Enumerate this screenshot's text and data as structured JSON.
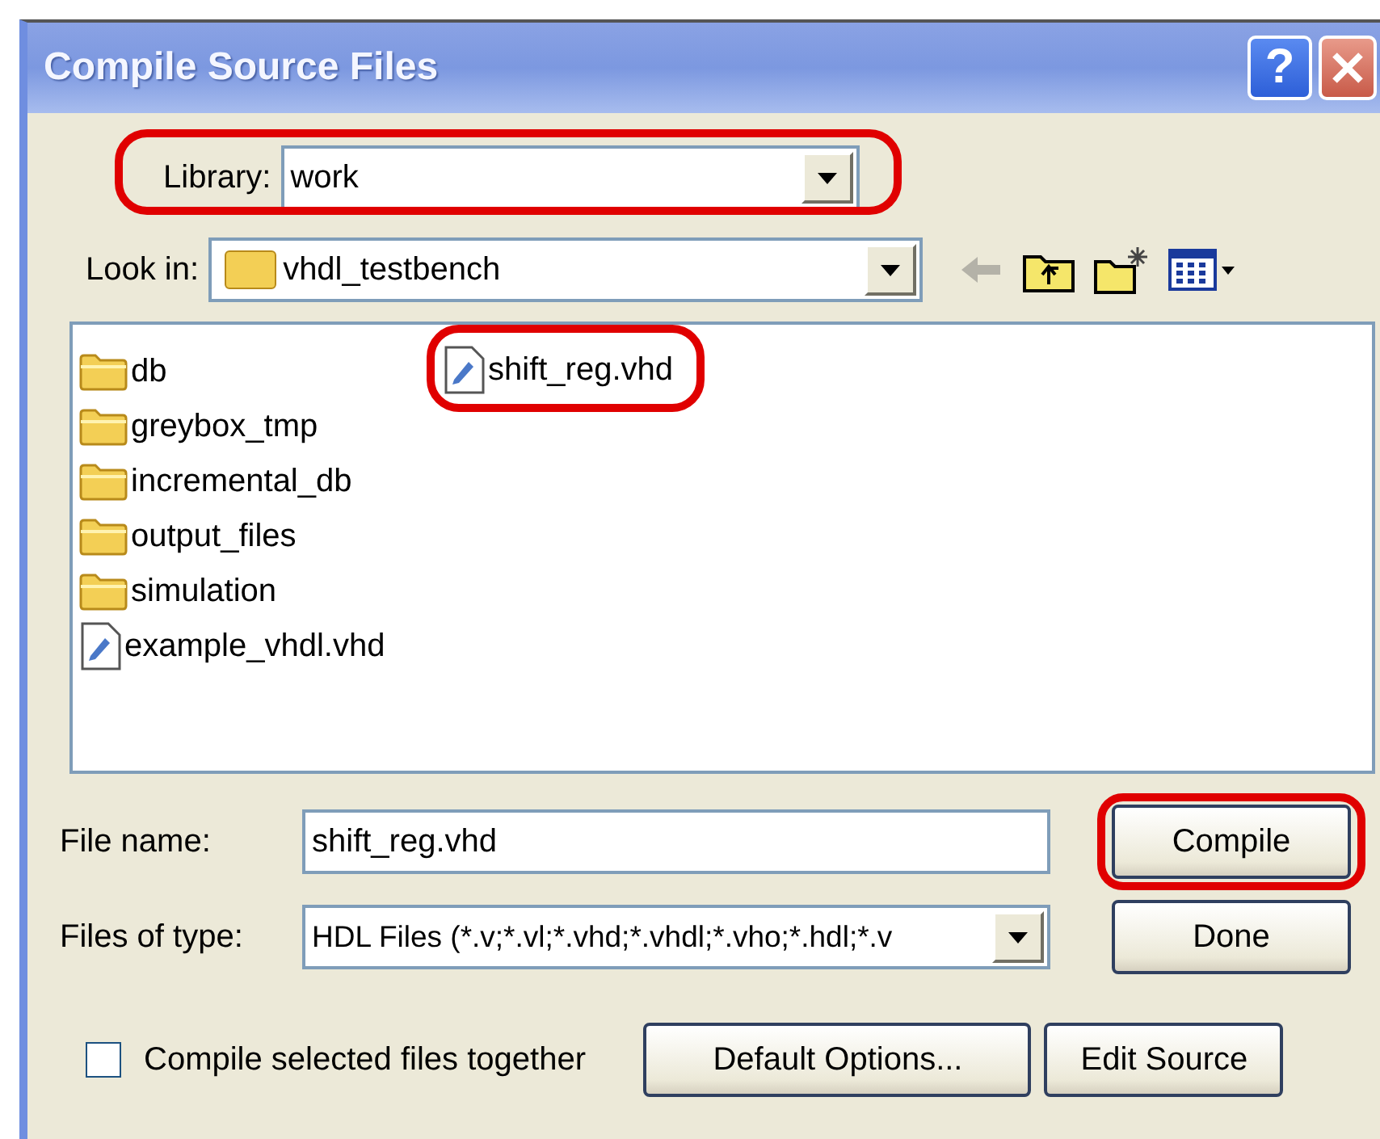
{
  "window": {
    "title": "Compile Source Files",
    "buttons": [
      {
        "kind": "help",
        "label": "?"
      },
      {
        "kind": "close"
      }
    ]
  },
  "library": {
    "label": "Library:",
    "value": "work",
    "highlighted": true
  },
  "look_in": {
    "label": "Look in:",
    "value": "vhdl_testbench"
  },
  "toolbar": [
    {
      "kind": "back",
      "disabled": true
    },
    {
      "kind": "up"
    },
    {
      "kind": "new-folder"
    },
    {
      "kind": "view"
    }
  ],
  "files": [
    {
      "name": "db",
      "kind": "folder",
      "highlighted": false
    },
    {
      "name": "greybox_tmp",
      "kind": "folder",
      "highlighted": false
    },
    {
      "name": "incremental_db",
      "kind": "folder",
      "highlighted": false
    },
    {
      "name": "output_files",
      "kind": "folder",
      "highlighted": false
    },
    {
      "name": "simulation",
      "kind": "folder",
      "highlighted": false
    },
    {
      "name": "example_vhdl.vhd",
      "kind": "file",
      "highlighted": false
    },
    {
      "name": "shift_reg.vhd",
      "kind": "file",
      "highlighted": true
    }
  ],
  "file_name": {
    "label": "File name:",
    "value": "shift_reg.vhd"
  },
  "files_of_type": {
    "label": "Files of type:",
    "value": "HDL Files (*.v;*.vl;*.vhd;*.vhdl;*.vho;*.hdl;*.v"
  },
  "compile_together": {
    "label": "Compile selected files together",
    "checked": false
  },
  "buttons": [
    {
      "kind": "compile",
      "label": "Compile",
      "highlighted": true
    },
    {
      "kind": "done",
      "label": "Done",
      "highlighted": false
    },
    {
      "kind": "default-options",
      "label": "Default Options...",
      "highlighted": false
    },
    {
      "kind": "edit-source",
      "label": "Edit Source",
      "highlighted": false
    }
  ]
}
